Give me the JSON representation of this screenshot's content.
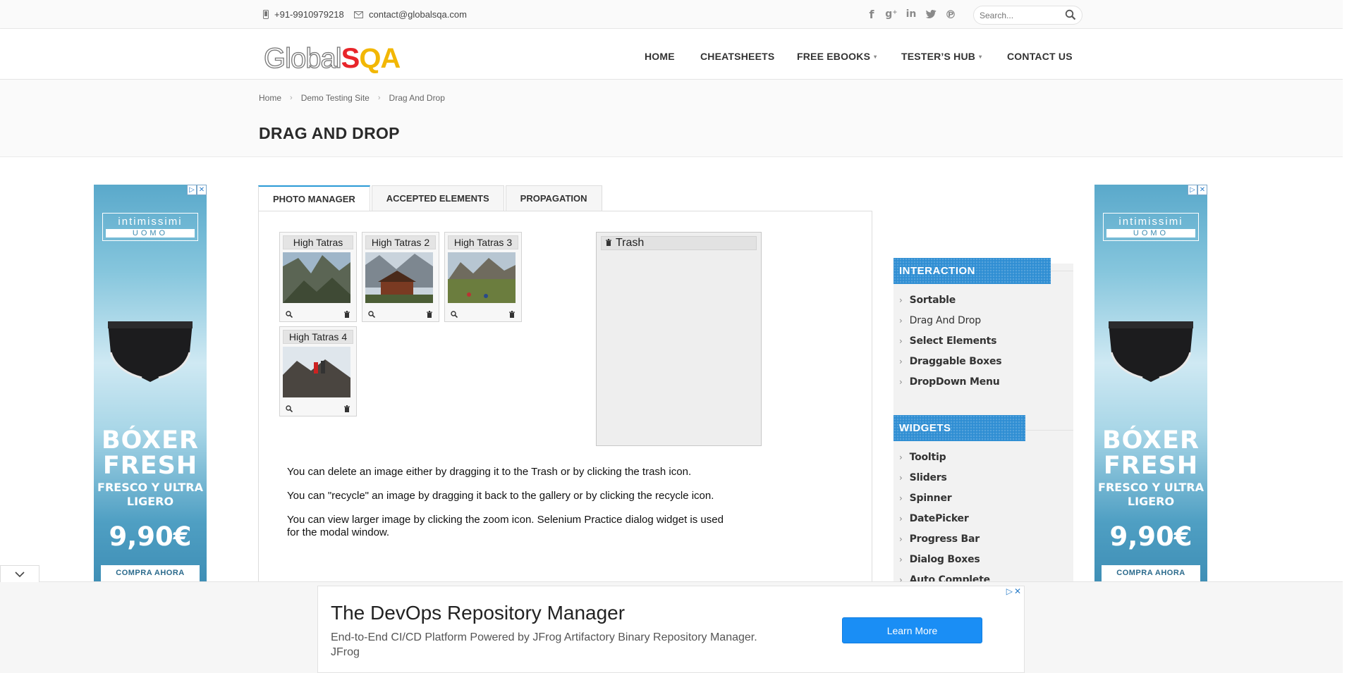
{
  "topbar": {
    "phone": "+91-9910979218",
    "email": "contact@globalsqa.com",
    "social_icons": [
      "facebook-icon",
      "google-plus-icon",
      "linkedin-icon",
      "twitter-icon",
      "pinterest-icon"
    ],
    "search_placeholder": "Search..."
  },
  "header": {
    "logo_part1": "Global",
    "logo_part2": "S",
    "logo_part3": "QA",
    "nav": [
      "HOME",
      "CHEATSHEETS",
      "FREE EBOOKS",
      "TESTER’S HUB",
      "CONTACT US"
    ]
  },
  "breadcrumb": [
    "Home",
    "Demo Testing Site",
    "Drag And Drop"
  ],
  "page_title": "DRAG AND DROP",
  "side_ad": {
    "brand_line1": "intimissimi",
    "brand_line2": "UOMO",
    "headline": "BÓXER FRESH",
    "subline": "FRESCO Y ULTRA LIGERO",
    "price": "9,90€",
    "cta": "COMPRA AHORA"
  },
  "tabs": [
    "PHOTO MANAGER",
    "ACCEPTED ELEMENTS",
    "PROPAGATION"
  ],
  "gallery": [
    "High Tatras",
    "High Tatras 2",
    "High Tatras 3",
    "High Tatras 4"
  ],
  "trash_title": "Trash",
  "info": [
    "You can delete an image either by dragging it to the Trash or by clicking the trash icon.",
    "You can \"recycle\" an image by dragging it back to the gallery or by clicking the recycle icon.",
    "You can view larger image by clicking the zoom icon. Selenium Practice dialog widget is used for the modal window."
  ],
  "sidebar": {
    "interaction_title": "INTERACTION",
    "interaction_items": [
      "Sortable",
      "Drag And Drop",
      "Select Elements",
      "Draggable Boxes",
      "DropDown Menu"
    ],
    "widgets_title": "WIDGETS",
    "widget_items": [
      "Tooltip",
      "Sliders",
      "Spinner",
      "DatePicker",
      "Progress Bar",
      "Dialog Boxes",
      "Auto Complete"
    ]
  },
  "bottom_ad": {
    "title": "The DevOps Repository Manager",
    "desc": "End-to-End CI/CD Platform Powered by JFrog Artifactory Binary Repository Manager.",
    "advertiser": "JFrog",
    "cta": "Learn More"
  },
  "colors": {
    "accent_blue": "#2f8ed3",
    "tab_active_border": "#2a9ad6",
    "logo_red": "#e8252a",
    "logo_yellow": "#f2b705",
    "cta_blue": "#1a8ef5"
  }
}
